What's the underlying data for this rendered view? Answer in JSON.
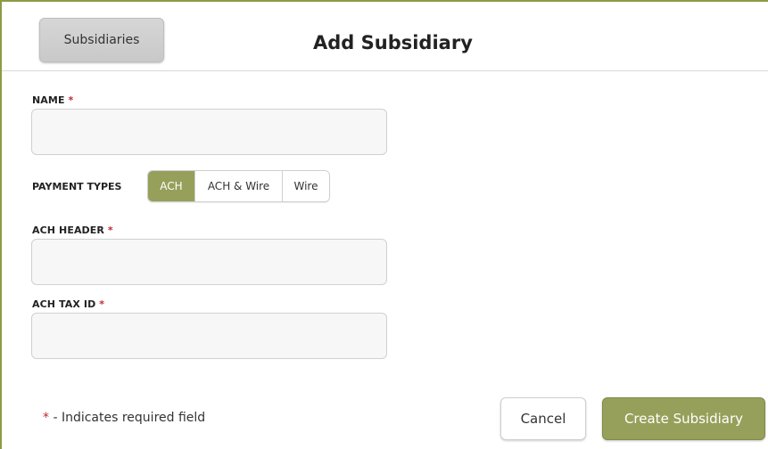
{
  "header": {
    "back_label": "Subsidiaries",
    "title": "Add Subsidiary"
  },
  "form": {
    "name": {
      "label": "NAME",
      "required_mark": "*",
      "value": "",
      "placeholder": ""
    },
    "payment_types": {
      "label": "PAYMENT TYPES",
      "options": [
        "ACH",
        "ACH & Wire",
        "Wire"
      ],
      "selected": "ACH"
    },
    "ach_header": {
      "label": "ACH HEADER",
      "required_mark": "*",
      "value": "",
      "placeholder": ""
    },
    "ach_tax_id": {
      "label": "ACH TAX ID",
      "required_mark": "*",
      "value": "",
      "placeholder": ""
    }
  },
  "footer": {
    "required_mark": "*",
    "note": " - Indicates required field",
    "cancel_label": "Cancel",
    "create_label": "Create Subsidiary"
  },
  "colors": {
    "accent": "#96a05a",
    "required": "#c0282d",
    "frame": "#8d9a44"
  }
}
